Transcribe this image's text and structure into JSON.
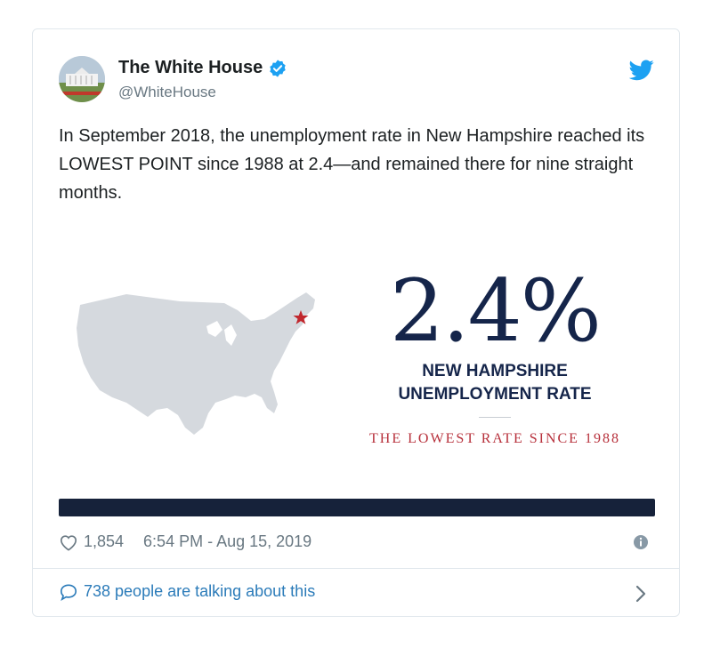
{
  "account": {
    "name": "The White House",
    "handle": "@WhiteHouse",
    "verified_icon": "verified-badge-icon",
    "platform_icon": "twitter-bird-icon"
  },
  "tweet": {
    "text": "In September 2018, the unemployment rate in New Hampshire reached its LOWEST POINT since 1988 at 2.4—and remained there for nine straight months."
  },
  "media": {
    "headline_value": "2.4%",
    "subtitle_line1": "NEW HAMPSHIRE",
    "subtitle_line2": "UNEMPLOYMENT RATE",
    "caption": "THE LOWEST RATE SINCE 1988",
    "colors": {
      "navy": "#15254a",
      "red": "#b7303b",
      "map_gray": "#d5d9de"
    }
  },
  "footer": {
    "likes": "1,854",
    "timestamp": "6:54 PM - Aug 15, 2019",
    "talking": "738 people are talking about this",
    "info_icon": "info-icon",
    "chevron_icon": "chevron-right-icon"
  }
}
